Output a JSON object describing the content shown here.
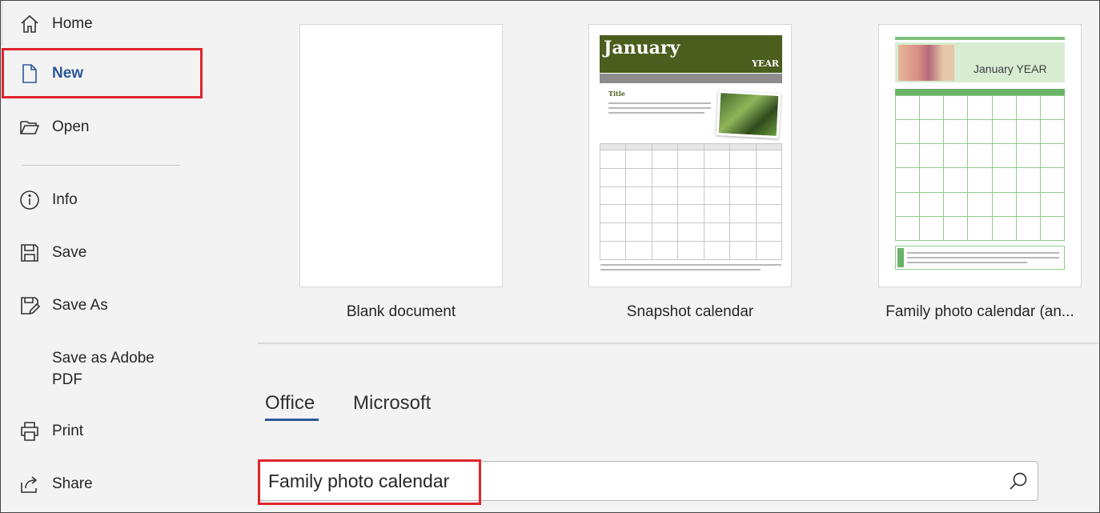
{
  "sidebar": {
    "items": [
      {
        "label": "Home",
        "icon": "home-icon"
      },
      {
        "label": "New",
        "icon": "new-document-icon"
      },
      {
        "label": "Open",
        "icon": "folder-open-icon"
      },
      {
        "label": "Info",
        "icon": "info-icon"
      },
      {
        "label": "Save",
        "icon": "save-icon"
      },
      {
        "label": "Save As",
        "icon": "save-as-icon"
      },
      {
        "label": "Save as Adobe\nPDF",
        "icon": ""
      },
      {
        "label": "Print",
        "icon": "printer-icon"
      },
      {
        "label": "Share",
        "icon": "share-icon"
      }
    ],
    "active": "New"
  },
  "templates": [
    {
      "caption": "Blank document"
    },
    {
      "caption": "Snapshot calendar",
      "thumb_month": "January",
      "thumb_year": "YEAR",
      "thumb_title": "Title"
    },
    {
      "caption": "Family photo calendar (an...",
      "thumb_month": "January YEAR"
    }
  ],
  "tabs": [
    {
      "label": "Office",
      "selected": true
    },
    {
      "label": "Microsoft",
      "selected": false
    }
  ],
  "search": {
    "value": "Family photo calendar"
  },
  "colors": {
    "accent": "#2b579a",
    "highlight": "#e0242c",
    "snapshot_green": "#4b5e1d",
    "family_green": "#6bb267"
  }
}
